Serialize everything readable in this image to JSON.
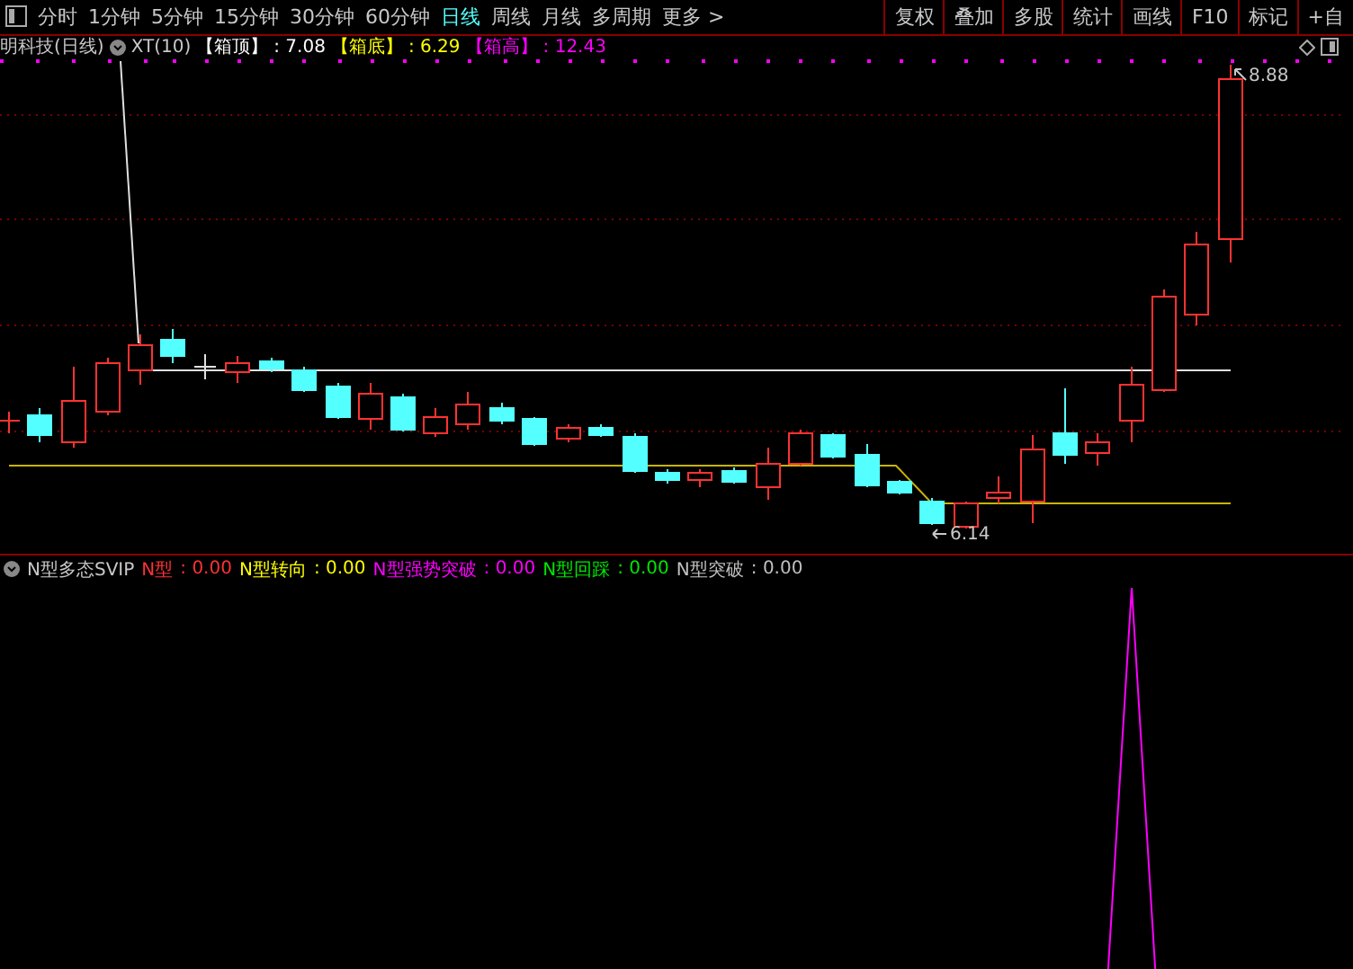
{
  "period_tabs": [
    {
      "label": "分时",
      "selected": false
    },
    {
      "label": "1分钟",
      "selected": false
    },
    {
      "label": "5分钟",
      "selected": false
    },
    {
      "label": "15分钟",
      "selected": false
    },
    {
      "label": "30分钟",
      "selected": false
    },
    {
      "label": "60分钟",
      "selected": false
    },
    {
      "label": "日线",
      "selected": true
    },
    {
      "label": "周线",
      "selected": false
    },
    {
      "label": "月线",
      "selected": false
    },
    {
      "label": "多周期",
      "selected": false
    },
    {
      "label": "更多 >",
      "selected": false
    }
  ],
  "tool_buttons": [
    "复权",
    "叠加",
    "多股",
    "统计",
    "画线",
    "F10",
    "标记",
    "+自"
  ],
  "chart_legend": {
    "title": "明科技(日线)",
    "indicator": "XT(10)",
    "items": [
      {
        "label": "【箱顶】",
        "value": ": 7.08",
        "color": "#ffffff"
      },
      {
        "label": "【箱底】",
        "value": ": 6.29",
        "color": "#ffff00"
      },
      {
        "label": "【箱高】",
        "value": ": 12.43",
        "color": "#ff00ff"
      }
    ]
  },
  "price_labels": [
    {
      "text": "8.88"
    },
    {
      "text": "6.14"
    }
  ],
  "indicator_legend": {
    "name": "N型多态SVIP",
    "items": [
      {
        "label": "N型",
        "value": ": 0.00",
        "color": "#ff3232"
      },
      {
        "label": "N型转向",
        "value": ": 0.00",
        "color": "#ffff00"
      },
      {
        "label": "N型强势突破",
        "value": ": 0.00",
        "color": "#ff00ff"
      },
      {
        "label": "N型回踩",
        "value": ": 0.00",
        "color": "#00e600"
      },
      {
        "label": "N型突破",
        "value": ": 0.00",
        "color": "#c0c0c0"
      }
    ]
  }
}
